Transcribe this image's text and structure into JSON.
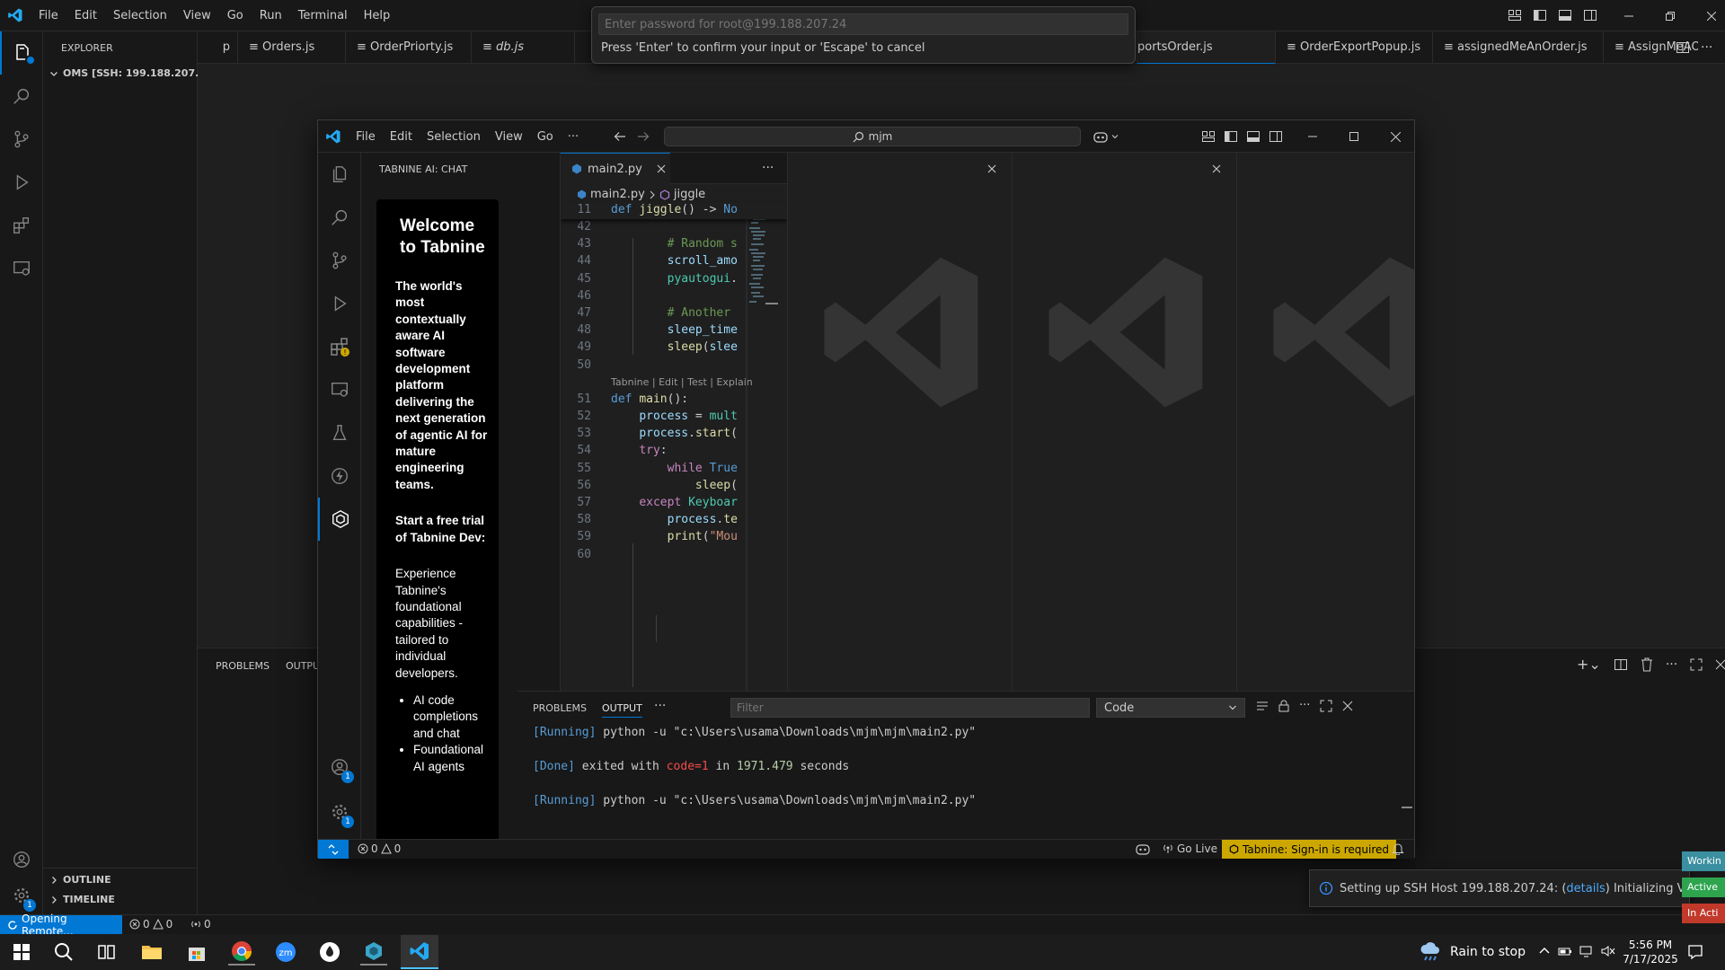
{
  "bg_window": {
    "menu": [
      "File",
      "Edit",
      "Selection",
      "View",
      "Go",
      "Run",
      "Terminal",
      "Help"
    ],
    "explorer_title": "EXPLORER",
    "folder_name": "OMS [SSH: 199.188.207.24]",
    "outline_label": "OUTLINE",
    "timeline_label": "TIMELINE",
    "tabs": [
      "p",
      "Orders.js",
      "OrderPriorty.js",
      "db.js",
      "portsOrder.js",
      "OrderExportPopup.js",
      "assignedMeAnOrder.js",
      "AssignMeAOr"
    ],
    "panel_tabs": [
      "PROBLEMS",
      "OUTPU"
    ],
    "status_remote": "Opening Remote...",
    "status_errors": "0",
    "status_warnings": "0",
    "status_ports": "0"
  },
  "quick_input": {
    "placeholder": "Enter password for root@199.188.207.24",
    "message": "Press 'Enter' to confirm your input or 'Escape' to cancel"
  },
  "fg_window": {
    "menu": [
      "File",
      "Edit",
      "Selection",
      "View",
      "Go",
      "···"
    ],
    "search_text": "mjm",
    "sidebar_title": "TABNINE AI: CHAT",
    "tabnine": {
      "welcome": "Welcome to Tabnine",
      "tagline": "The world's most contextually aware AI software development platform delivering the next generation of agentic AI for mature engineering teams.",
      "trial_title": "Start a free trial of Tabnine Dev:",
      "trial_desc": "Experience Tabnine's foundational capabilities - tailored to individual developers.",
      "bullets": [
        "AI code completions and chat",
        "Foundational AI agents"
      ]
    },
    "editor_tab": "main2.py",
    "breadcrumb": [
      "main2.py",
      "jiggle"
    ],
    "sticky_line": {
      "num": "11",
      "text": "def jiggle() -> No"
    },
    "codelens": "Tabnine | Edit | Test | Explain",
    "code_lines": [
      {
        "n": "42",
        "t": ""
      },
      {
        "n": "43",
        "t": "        # Random s"
      },
      {
        "n": "44",
        "t": "        scroll_amo"
      },
      {
        "n": "45",
        "t": "        pyautogui."
      },
      {
        "n": "46",
        "t": ""
      },
      {
        "n": "47",
        "t": "        # Another"
      },
      {
        "n": "48",
        "t": "        sleep_time"
      },
      {
        "n": "49",
        "t": "        sleep(slee"
      },
      {
        "n": "50",
        "t": ""
      },
      {
        "n": "51",
        "t": "def main():"
      },
      {
        "n": "52",
        "t": "    process = mult"
      },
      {
        "n": "53",
        "t": "    process.start("
      },
      {
        "n": "54",
        "t": "    try:"
      },
      {
        "n": "55",
        "t": "        while True"
      },
      {
        "n": "56",
        "t": "            sleep("
      },
      {
        "n": "57",
        "t": "    except Keyboar"
      },
      {
        "n": "58",
        "t": "        process.te"
      },
      {
        "n": "59",
        "t": "        print(\"Mou"
      },
      {
        "n": "60",
        "t": ""
      }
    ],
    "panel_tabs": [
      "PROBLEMS",
      "OUTPUT",
      "···"
    ],
    "filter_placeholder": "Filter",
    "output_channel": "Code",
    "output_lines": [
      {
        "tag": "[Running]",
        "text": " python -u \"c:\\Users\\usama\\Downloads\\mjm\\mjm\\main2.py\""
      },
      {
        "tag": "[Done]",
        "pre": " exited with ",
        "code": "code=1",
        "mid": " in ",
        "num": "1971.479",
        "post": " seconds"
      },
      {
        "tag": "[Running]",
        "text": " python -u \"c:\\Users\\usama\\Downloads\\mjm\\mjm\\main2.py\""
      }
    ],
    "status_errors": "0",
    "status_warnings": "0",
    "go_live": "Go Live",
    "tabnine_status": "Tabnine: Sign-in is required",
    "badge_count": "1"
  },
  "notification": {
    "prefix": "Setting up SSH Host 199.188.207.24: (",
    "link": "details",
    "suffix": ") Initializing VS Code"
  },
  "side_buttons": [
    {
      "label": "Workin",
      "color": "#3a8fa0"
    },
    {
      "label": "Active",
      "color": "#2ea44f"
    },
    {
      "label": "In Acti",
      "color": "#c0392b"
    }
  ],
  "taskbar": {
    "weather": "Rain to stop",
    "time": "5:56 PM",
    "date": "7/17/2025"
  },
  "colors": {
    "accent": "#0078d4",
    "tabnine_yellow": "#cca700"
  }
}
